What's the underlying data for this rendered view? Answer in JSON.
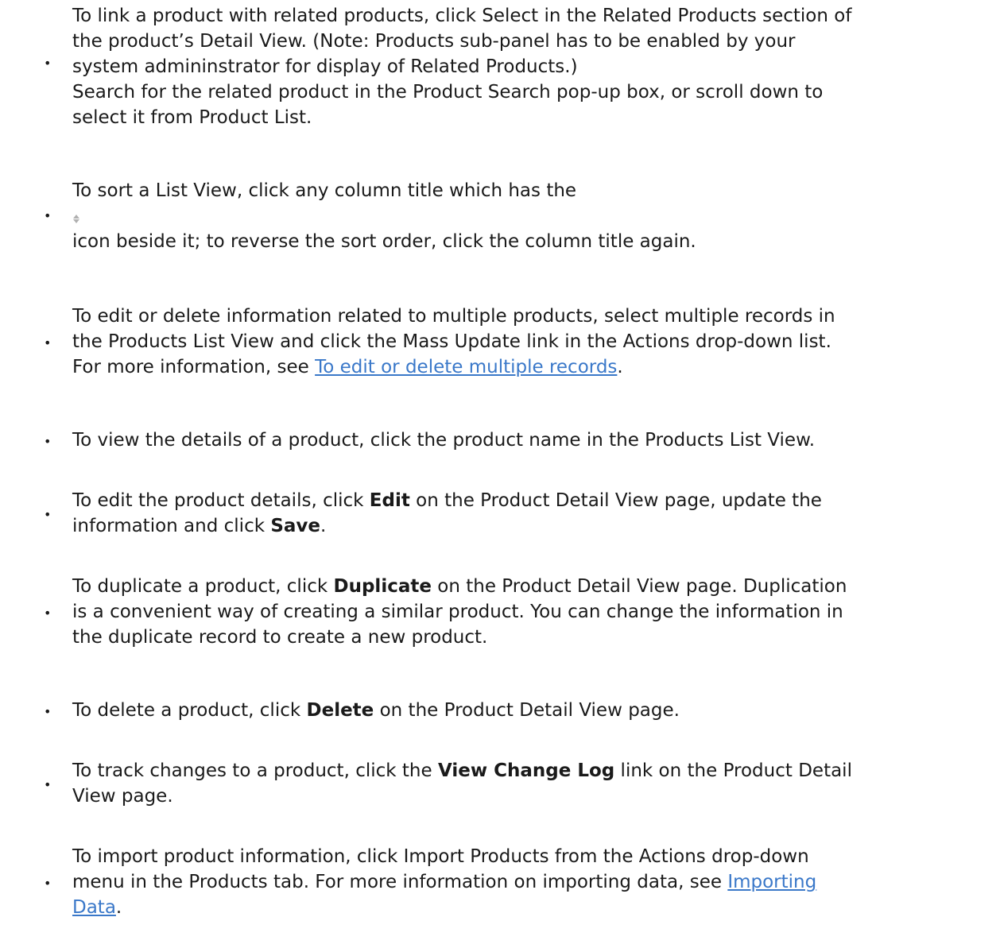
{
  "items": [
    {
      "lines": [
        "To link a product with related products, click Select in the Related Products section of",
        "the product’s Detail View. (Note: Products sub-panel has to be enabled by your",
        "system admininstrator for display of Related Products.)",
        "Search for the related product in the Product Search pop-up box, or scroll down to",
        "select it from Product List."
      ]
    },
    {
      "line1": "To sort a List View, click any column title which has the",
      "icon": "sort-icon",
      "line3": "icon beside it; to reverse the sort order, click the column title again."
    },
    {
      "line1": "To edit or delete information related to multiple products, select multiple records in",
      "line2": "the Products List View and click the Mass Update link in the Actions drop-down list.",
      "line3_pre": "For more information, see ",
      "line3_link": "To edit or delete multiple records",
      "line3_post": "."
    },
    {
      "line1": "To view the details of a product, click the product name in the Products List View."
    },
    {
      "line1_pre": "To edit the product details, click ",
      "line1_bold": "Edit",
      "line1_post": " on the Product Detail View page, update the",
      "line2_pre": "information and click ",
      "line2_bold": "Save",
      "line2_post": "."
    },
    {
      "line1_pre": "To duplicate a product, click ",
      "line1_bold": "Duplicate",
      "line1_post": " on the Product Detail View page. Duplication",
      "line2": "is a convenient way of creating a similar product. You can change the information in",
      "line3": "the duplicate record to create a new product."
    },
    {
      "line1_pre": "To delete a product, click ",
      "line1_bold": "Delete",
      "line1_post": " on the Product Detail View page."
    },
    {
      "line1_pre": "To track changes to a product, click the ",
      "line1_bold": "View Change Log",
      "line1_post": " link on the Product Detail",
      "line2": "View page."
    },
    {
      "line1": "To import product information, click Import Products from the Actions drop-down",
      "line2_pre": "menu in the Products tab. For more information on importing data, see ",
      "line2_link": "Importing",
      "line3_link": "Data",
      "line3_post": "."
    }
  ],
  "colors": {
    "text": "#1a1a1a",
    "link": "#3a78c9"
  }
}
